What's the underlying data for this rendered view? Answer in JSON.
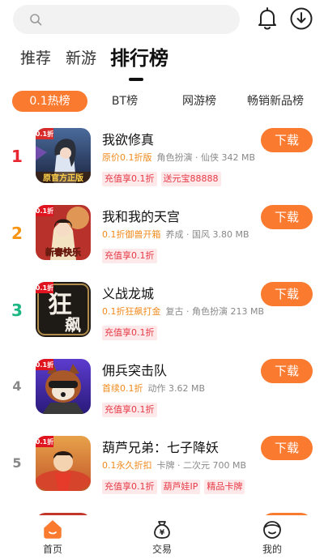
{
  "colors": {
    "accent": "#fa7a2f",
    "rank1": "#e8262f",
    "rank2": "#f79513",
    "rank3": "#1cb782",
    "tag_text": "#e63946",
    "tag_bg": "#fde9ea",
    "promo": "#f08a1c"
  },
  "header": {
    "search_icon": "search-icon",
    "bell_icon": "bell-icon",
    "download_icon": "download-circle-icon"
  },
  "main_tabs": [
    "推荐",
    "新游",
    "排行榜"
  ],
  "sub_tabs": [
    "0.1热榜",
    "BT榜",
    "网游榜",
    "畅销新品榜"
  ],
  "games": [
    {
      "rank": "1",
      "name": "我欲修真",
      "promo": "原价0.1折版",
      "category": "角色扮演 · 仙侠",
      "size": "342 MB",
      "tags": [
        "充值享0.1折",
        "送元宝88888"
      ],
      "button": "下载"
    },
    {
      "rank": "2",
      "name": "我和我的天宫",
      "promo": "0.1折御兽开箱",
      "category": "养成 · 国风",
      "size": "3.80 MB",
      "tags": [
        "充值享0.1折"
      ],
      "button": "下载"
    },
    {
      "rank": "3",
      "name": "义战龙城",
      "promo": "0.1折狂飙打金",
      "category": "复古 · 角色扮演",
      "size": "213 MB",
      "tags": [
        "充值享0.1折"
      ],
      "button": "下载"
    },
    {
      "rank": "4",
      "name": "佣兵突击队",
      "promo": "首续0.1折",
      "category": "动作",
      "size": "3.62 MB",
      "tags": [
        "充值享0.1折"
      ],
      "button": "下载"
    },
    {
      "rank": "5",
      "name": "葫芦兄弟：七子降妖",
      "promo": "0.1永久折扣",
      "category": "卡牌 · 二次元",
      "size": "700 MB",
      "tags": [
        "充值享0.1折",
        "葫芦娃IP",
        "精品卡牌"
      ],
      "button": "下载"
    }
  ],
  "icon_texts": {
    "g1_top": "0.1折",
    "g1_bottom": "原官方正版",
    "g2_top": "0.1折",
    "g2_bottom": "新春快乐",
    "g3_top": "0.1折",
    "g3_mid": "狂",
    "g3_bottom": "飙",
    "g4_top": "0.1折",
    "g5_top": "0.1折"
  },
  "bottom_nav": [
    {
      "label": "首页",
      "icon": "home-icon"
    },
    {
      "label": "交易",
      "icon": "money-bag-icon"
    },
    {
      "label": "我的",
      "icon": "profile-face-icon"
    }
  ]
}
